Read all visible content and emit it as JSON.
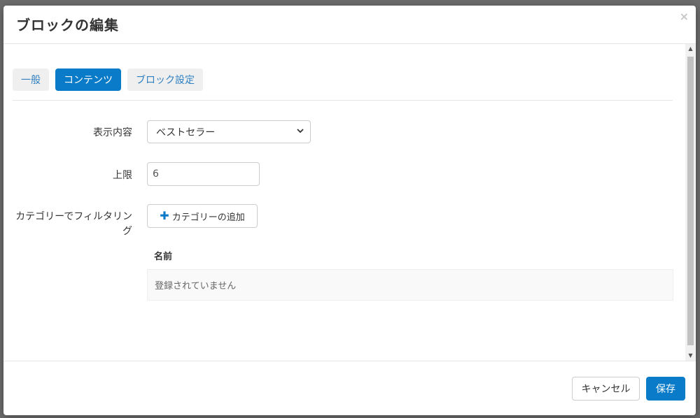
{
  "modal": {
    "title": "ブロックの編集",
    "close_glyph": "×"
  },
  "tabs": [
    {
      "label": "一般",
      "active": false
    },
    {
      "label": "コンテンツ",
      "active": true
    },
    {
      "label": "ブロック設定",
      "active": false
    }
  ],
  "form": {
    "display_content": {
      "label": "表示内容",
      "value": "ベストセラー"
    },
    "limit": {
      "label": "上限",
      "value": "6"
    },
    "category_filter": {
      "label_line1": "カテゴリーでフィルタリン",
      "label_line2": "グ",
      "add_button": "カテゴリーの追加",
      "table_header_name": "名前",
      "empty_text": "登録されていません"
    }
  },
  "footer": {
    "cancel": "キャンセル",
    "save": "保存"
  },
  "colors": {
    "primary": "#0a7bc8",
    "backdrop": "#6c6c6c"
  },
  "icons": {
    "close": "close-icon",
    "chevron": "chevron-down-icon",
    "plus": "plus-icon"
  }
}
